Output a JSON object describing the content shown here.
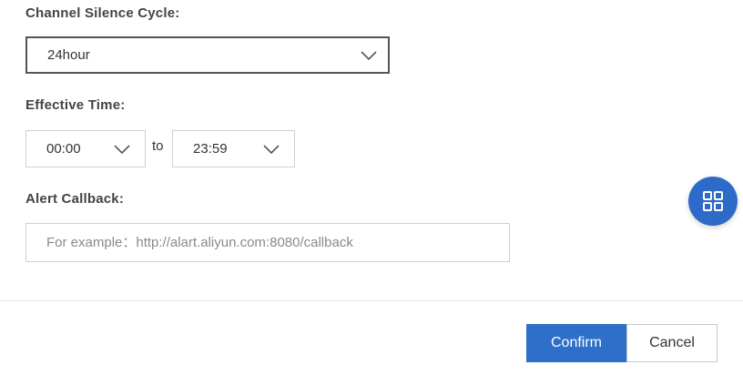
{
  "silence_cycle": {
    "label": "Channel Silence Cycle:",
    "selected": "24hour"
  },
  "effective_time": {
    "label": "Effective Time:",
    "start": "00:00",
    "separator": "to",
    "end": "23:59"
  },
  "alert_callback": {
    "label": "Alert Callback:",
    "value": "",
    "placeholder": "For example：http://alart.aliyun.com:8080/callback"
  },
  "footer": {
    "confirm_label": "Confirm",
    "cancel_label": "Cancel"
  },
  "floating_button": {
    "icon": "grid-icon"
  },
  "colors": {
    "primary": "#2e6fc9",
    "float_button": "#2e6ac8",
    "border": "#d0d0d0",
    "label": "#444444"
  }
}
